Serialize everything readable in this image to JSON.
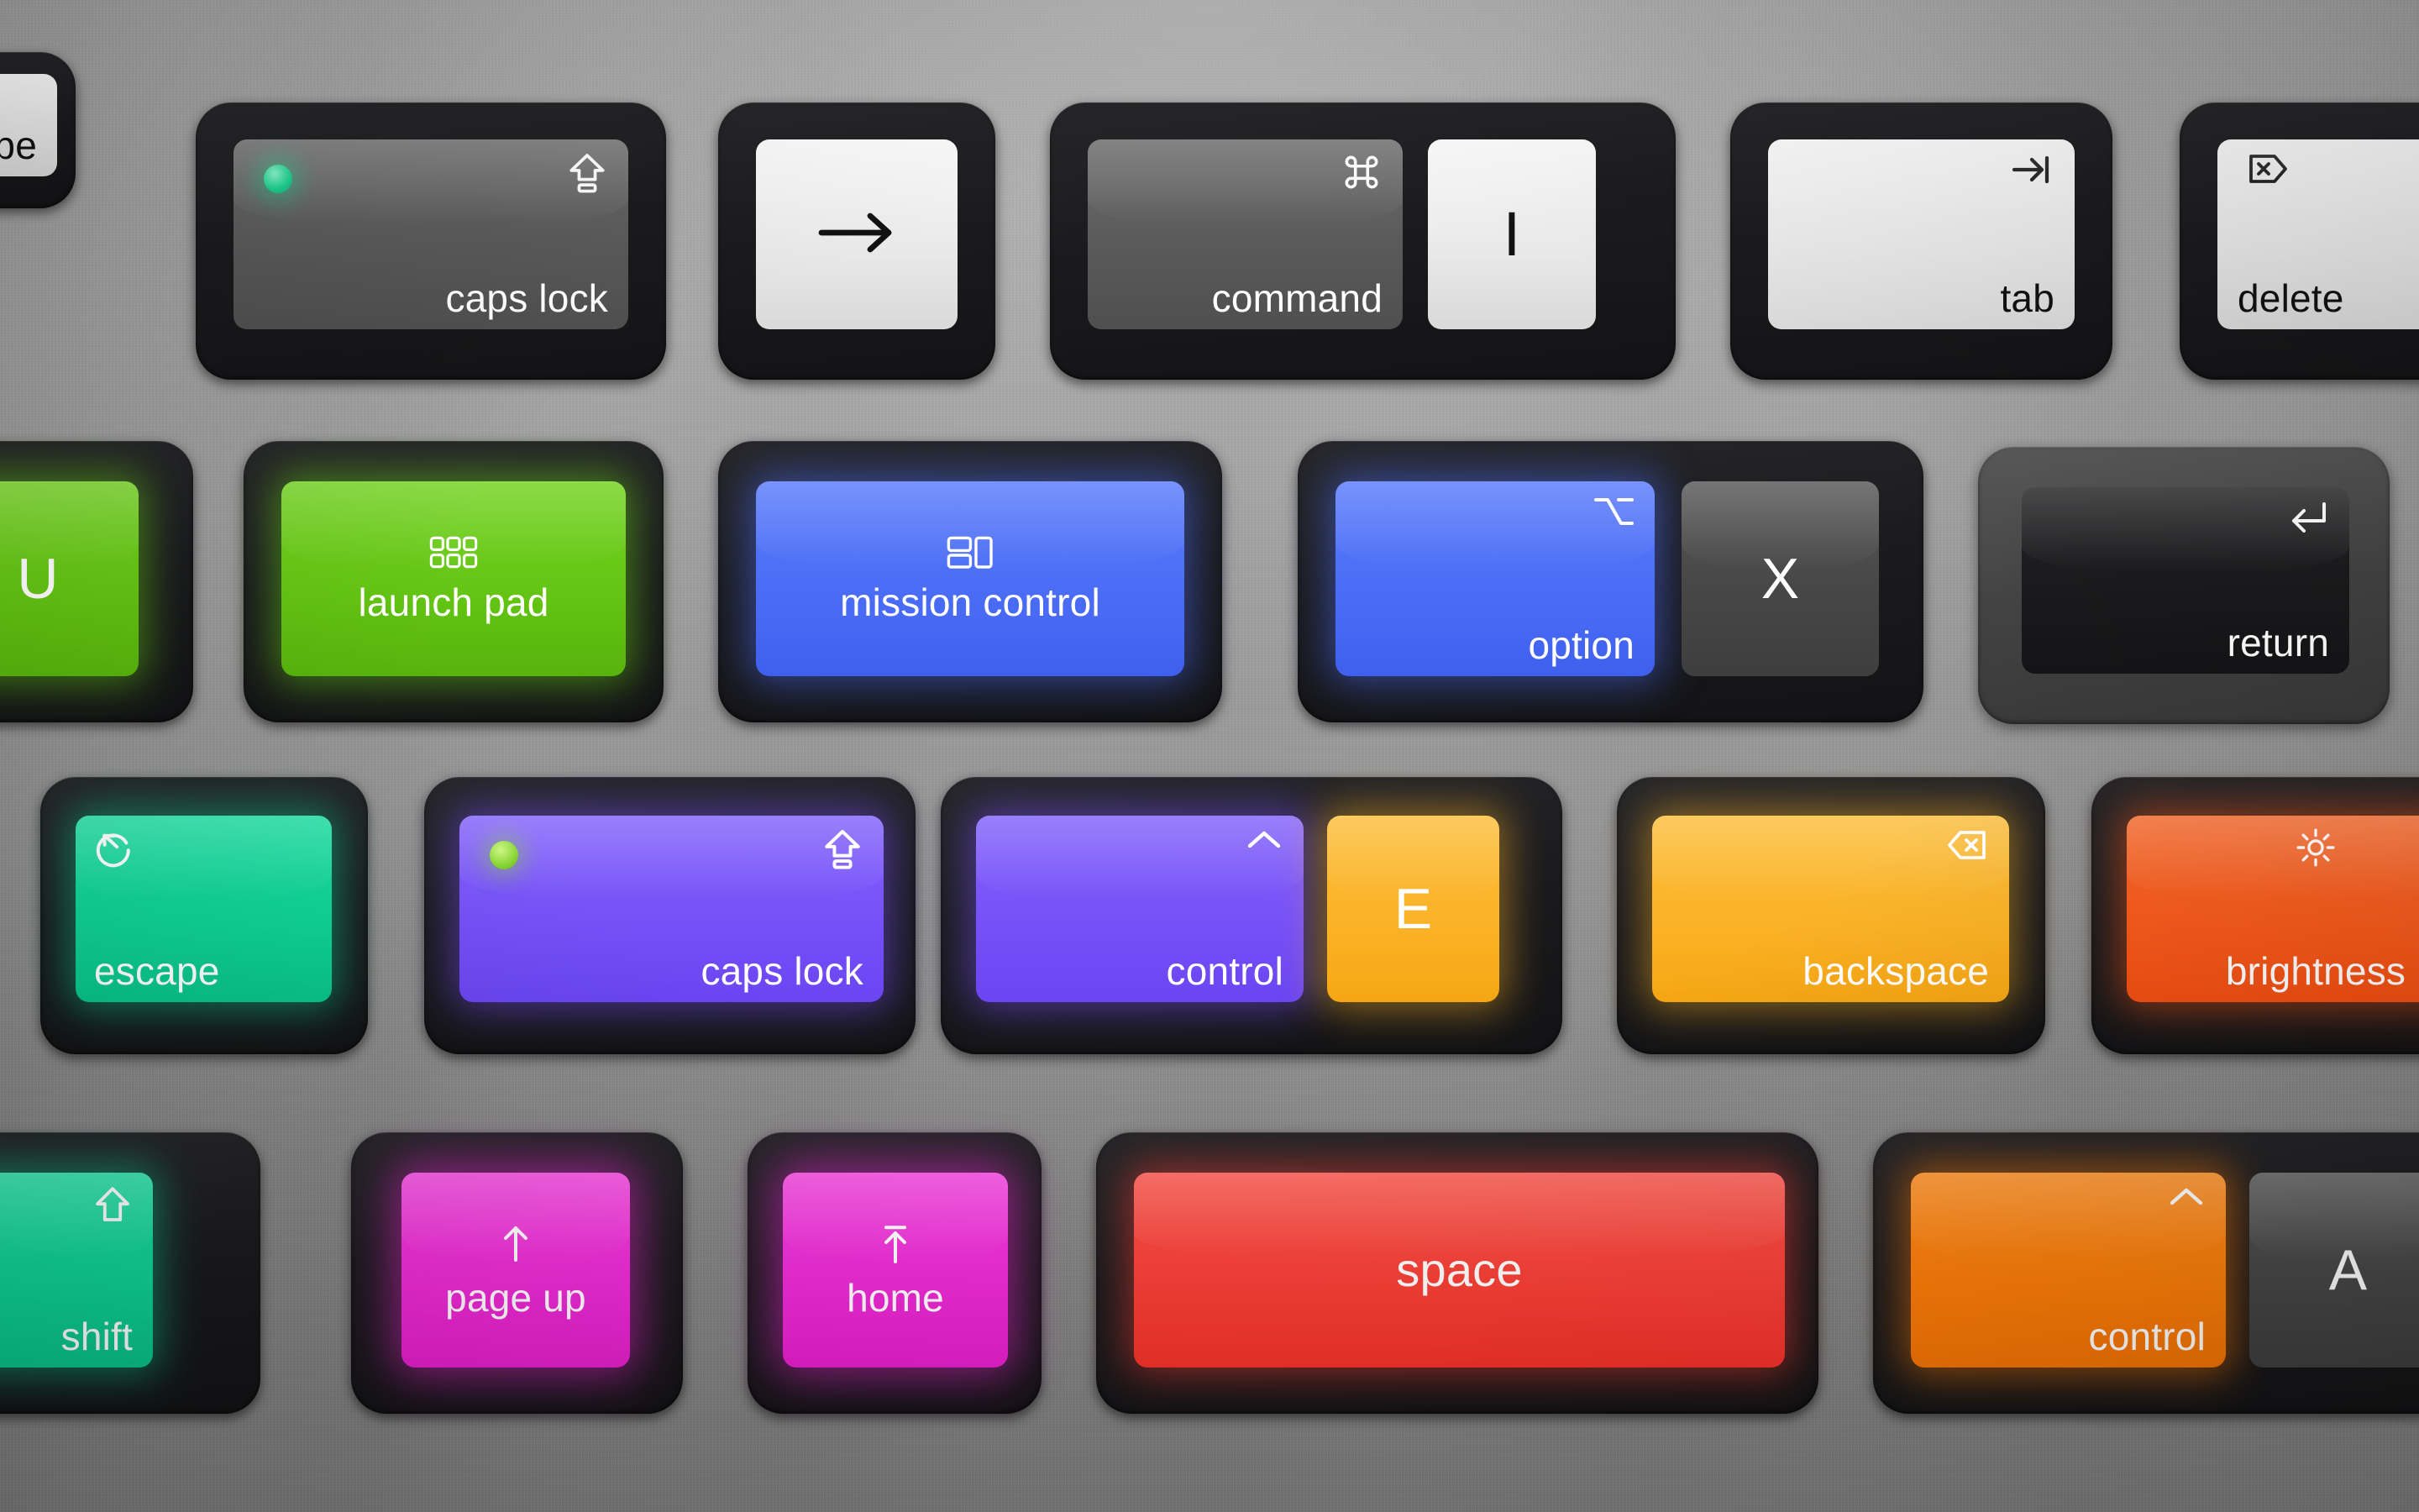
{
  "keyboard": {
    "title": "colorful mechanical keyboard close-up",
    "surface_color": "#8e8e8e",
    "housing_color": "#1b1b1e",
    "rows": [
      {
        "name": "row-1",
        "keys": [
          {
            "id": "escape-partial",
            "label": "pe",
            "glyph": "none",
            "theme": "white",
            "partial": true
          },
          {
            "id": "caps-lock-gray",
            "label": "caps lock",
            "glyph": "capslock",
            "theme": "gray",
            "led": "#0ad08a"
          },
          {
            "id": "right-arrow",
            "label": "",
            "glyph": "arrow-right",
            "theme": "white"
          },
          {
            "id": "command",
            "label": "command",
            "glyph": "command",
            "theme": "gray"
          },
          {
            "id": "letter-i",
            "label": "I",
            "glyph": "none",
            "theme": "white"
          },
          {
            "id": "tab",
            "label": "tab",
            "glyph": "tab",
            "theme": "white"
          },
          {
            "id": "delete",
            "label": "delete",
            "glyph": "forward-delete",
            "theme": "white"
          }
        ]
      },
      {
        "name": "row-2",
        "keys": [
          {
            "id": "letter-u",
            "label": "U",
            "glyph": "none",
            "theme": "green"
          },
          {
            "id": "launch-pad",
            "label": "launch pad",
            "glyph": "launchpad-grid",
            "theme": "green"
          },
          {
            "id": "mission-control",
            "label": "mission control",
            "glyph": "mission-control",
            "theme": "blue"
          },
          {
            "id": "option",
            "label": "option",
            "glyph": "option",
            "theme": "blue"
          },
          {
            "id": "letter-x",
            "label": "X",
            "glyph": "none",
            "theme": "darkgray"
          },
          {
            "id": "return",
            "label": "return",
            "glyph": "return",
            "theme": "black"
          }
        ]
      },
      {
        "name": "row-3",
        "keys": [
          {
            "id": "escape",
            "label": "escape",
            "glyph": "escape-circle",
            "theme": "teal"
          },
          {
            "id": "caps-lock-purple",
            "label": "caps lock",
            "glyph": "capslock",
            "theme": "purple",
            "led": "#7ed321"
          },
          {
            "id": "control-purple",
            "label": "control",
            "glyph": "control",
            "theme": "purple"
          },
          {
            "id": "letter-e",
            "label": "E",
            "glyph": "none",
            "theme": "amber"
          },
          {
            "id": "backspace",
            "label": "backspace",
            "glyph": "backspace",
            "theme": "amber"
          },
          {
            "id": "brightness",
            "label": "brightness",
            "glyph": "sun",
            "theme": "orangered"
          }
        ]
      },
      {
        "name": "row-4",
        "keys": [
          {
            "id": "shift",
            "label": "shift",
            "glyph": "shift",
            "theme": "teal"
          },
          {
            "id": "page-up",
            "label": "page up",
            "glyph": "arrow-up",
            "theme": "magenta"
          },
          {
            "id": "home",
            "label": "home",
            "glyph": "home-arrow",
            "theme": "magenta"
          },
          {
            "id": "space",
            "label": "space",
            "glyph": "none",
            "theme": "red"
          },
          {
            "id": "control-orange",
            "label": "control",
            "glyph": "control",
            "theme": "orange"
          },
          {
            "id": "letter-a",
            "label": "A",
            "glyph": "none",
            "theme": "darkgray"
          }
        ]
      }
    ]
  }
}
